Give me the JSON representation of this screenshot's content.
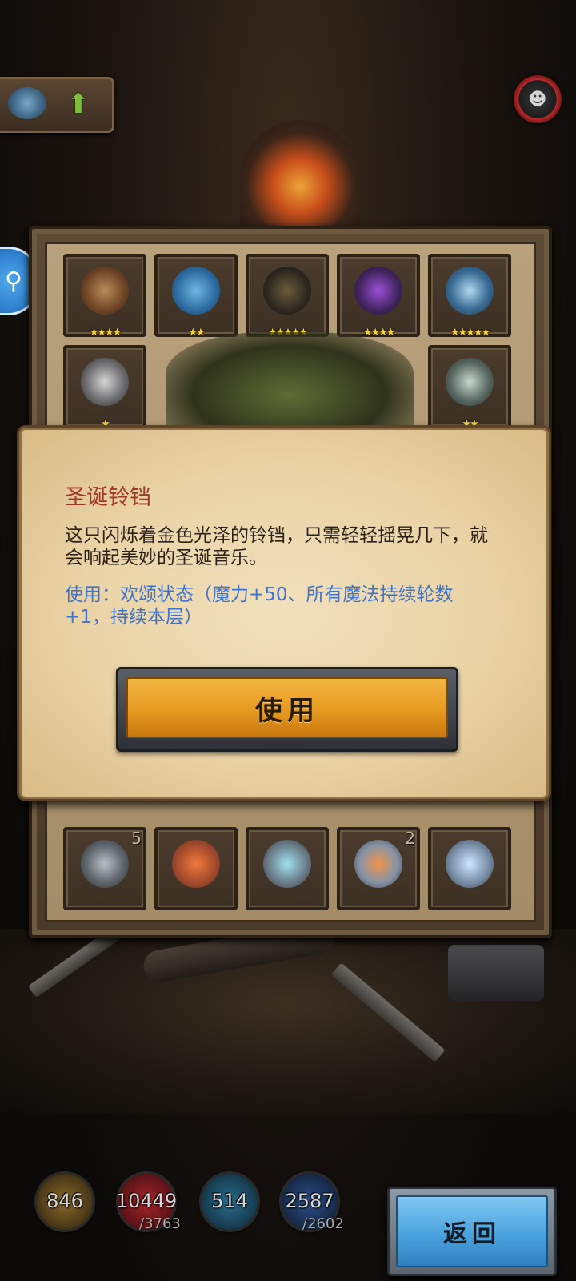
{
  "item": {
    "name": "圣诞铃铛",
    "description": "这只闪烁着金色光泽的铃铛，只需轻轻摇晃几下，就会响起美妙的圣诞音乐。",
    "use_effect": "使用：欢颂状态（魔力+50、所有魔法持续轮数+1，持续本层）"
  },
  "buttons": {
    "use_label": "使用",
    "back_label": "返回"
  },
  "equipment_slots": [
    {
      "icon": "armguard-icon",
      "stars": "★★★★",
      "rarity": 4
    },
    {
      "icon": "blue-armor-icon",
      "stars": "★★",
      "rarity": 2
    },
    {
      "icon": "helmet-icon",
      "stars": "★★★★★",
      "rarity": 5
    },
    {
      "icon": "dark-hat-icon",
      "stars": "★★★★",
      "rarity": 4
    },
    {
      "icon": "amulet-icon",
      "stars": "★★★★★",
      "rarity": 5
    },
    {
      "icon": "silver-ring-icon",
      "stars": "★",
      "rarity": 1
    },
    {
      "icon": "ring-icon",
      "stars": "★★",
      "rarity": 2
    }
  ],
  "material_slots": [
    {
      "icon": "ore-icon",
      "count": "5"
    },
    {
      "icon": "fire-rune-icon",
      "count": ""
    },
    {
      "icon": "moon-stone-icon",
      "count": ""
    },
    {
      "icon": "flame-stone-icon",
      "count": "2"
    },
    {
      "icon": "star-stone-icon",
      "count": ""
    }
  ],
  "resources": [
    {
      "name": "attack",
      "value": "846",
      "max": "",
      "color": "#8a6a2c"
    },
    {
      "name": "hp",
      "value": "10449",
      "max": "/3763",
      "color": "#a7252a"
    },
    {
      "name": "defense",
      "value": "514",
      "max": "",
      "color": "#2a6c8d"
    },
    {
      "name": "mana",
      "value": "2587",
      "max": "/2602",
      "color": "#2c4f86"
    }
  ],
  "colors": {
    "title": "#a0392a",
    "use_effect": "#3f73c9",
    "use_button": "#e79a20",
    "back_button": "#4aa3de"
  }
}
